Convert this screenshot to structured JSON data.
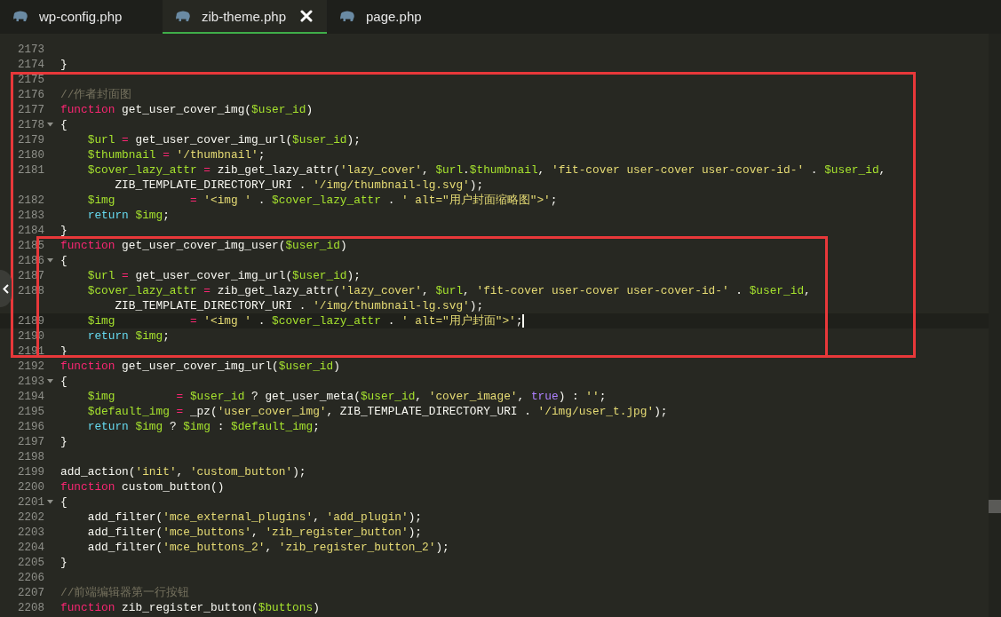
{
  "tabs": [
    {
      "label": "wp-config.php",
      "selected": false
    },
    {
      "label": "zib-theme.php",
      "selected": true
    },
    {
      "label": "page.php",
      "selected": false
    }
  ],
  "editor": {
    "lines": [
      {
        "number": "2173",
        "fold": false,
        "current": false
      },
      {
        "number": "2174",
        "fold": false,
        "current": false,
        "tokens": [
          {
            "kind": "plain",
            "text": "}"
          }
        ]
      },
      {
        "number": "2175",
        "fold": false,
        "current": false
      },
      {
        "number": "2176",
        "fold": false,
        "current": false,
        "tokens": [
          {
            "kind": "comment",
            "text": "//作者封面图"
          }
        ]
      },
      {
        "number": "2177",
        "fold": false,
        "current": false,
        "tokens": [
          {
            "kind": "keyword",
            "text": "function"
          },
          {
            "kind": "plain",
            "text": " get_user_cover_img("
          },
          {
            "kind": "variable",
            "text": "$user_id"
          },
          {
            "kind": "plain",
            "text": ")"
          }
        ]
      },
      {
        "number": "2178",
        "fold": true,
        "current": false,
        "tokens": [
          {
            "kind": "plain",
            "text": "{"
          }
        ]
      },
      {
        "number": "2179",
        "fold": false,
        "current": false,
        "tokens": [
          {
            "kind": "variable",
            "text": "    $url"
          },
          {
            "kind": "operator",
            "text": " ="
          },
          {
            "kind": "plain",
            "text": " get_user_cover_img_url("
          },
          {
            "kind": "variable",
            "text": "$user_id"
          },
          {
            "kind": "plain",
            "text": ");"
          }
        ]
      },
      {
        "number": "2180",
        "fold": false,
        "current": false,
        "tokens": [
          {
            "kind": "variable",
            "text": "    $thumbnail"
          },
          {
            "kind": "operator",
            "text": " ="
          },
          {
            "kind": "string",
            "text": " '/thumbnail'"
          },
          {
            "kind": "plain",
            "text": ";"
          }
        ]
      },
      {
        "number": "2181",
        "fold": false,
        "current": false,
        "tokens": [
          {
            "kind": "variable",
            "text": "    $cover_lazy_attr"
          },
          {
            "kind": "operator",
            "text": " ="
          },
          {
            "kind": "plain",
            "text": " zib_get_lazy_attr("
          },
          {
            "kind": "string",
            "text": "'lazy_cover'"
          },
          {
            "kind": "plain",
            "text": ", "
          },
          {
            "kind": "variable",
            "text": "$url"
          },
          {
            "kind": "plain",
            "text": "."
          },
          {
            "kind": "variable",
            "text": "$thumbnail"
          },
          {
            "kind": "plain",
            "text": ", "
          },
          {
            "kind": "string",
            "text": "'fit-cover user-cover user-cover-id-'"
          },
          {
            "kind": "plain",
            "text": " . "
          },
          {
            "kind": "variable",
            "text": "$user_id"
          },
          {
            "kind": "plain",
            "text": ","
          }
        ],
        "continuation": [
          {
            "kind": "plain",
            "text": "        ZIB_TEMPLATE_DIRECTORY_URI . "
          },
          {
            "kind": "string",
            "text": "'/img/thumbnail-lg.svg'"
          },
          {
            "kind": "plain",
            "text": ");"
          }
        ]
      },
      {
        "number": "2182",
        "fold": false,
        "current": false,
        "tokens": [
          {
            "kind": "variable",
            "text": "    $img"
          },
          {
            "kind": "operator",
            "text": "           ="
          },
          {
            "kind": "string",
            "text": " '<img '"
          },
          {
            "kind": "plain",
            "text": " . "
          },
          {
            "kind": "variable",
            "text": "$cover_lazy_attr"
          },
          {
            "kind": "plain",
            "text": " . "
          },
          {
            "kind": "string",
            "text": "' alt=\"用户封面缩略图\">'"
          },
          {
            "kind": "plain",
            "text": ";"
          }
        ]
      },
      {
        "number": "2183",
        "fold": false,
        "current": false,
        "tokens": [
          {
            "kind": "builtin",
            "text": "    return"
          },
          {
            "kind": "variable",
            "text": " $img"
          },
          {
            "kind": "plain",
            "text": ";"
          }
        ]
      },
      {
        "number": "2184",
        "fold": false,
        "current": false,
        "tokens": [
          {
            "kind": "plain",
            "text": "}"
          }
        ]
      },
      {
        "number": "2185",
        "fold": false,
        "current": false,
        "tokens": [
          {
            "kind": "keyword",
            "text": "function"
          },
          {
            "kind": "plain",
            "text": " get_user_cover_img_user("
          },
          {
            "kind": "variable",
            "text": "$user_id"
          },
          {
            "kind": "plain",
            "text": ")"
          }
        ]
      },
      {
        "number": "2186",
        "fold": true,
        "current": false,
        "tokens": [
          {
            "kind": "plain",
            "text": "{"
          }
        ]
      },
      {
        "number": "2187",
        "fold": false,
        "current": false,
        "tokens": [
          {
            "kind": "variable",
            "text": "    $url"
          },
          {
            "kind": "operator",
            "text": " ="
          },
          {
            "kind": "plain",
            "text": " get_user_cover_img_url("
          },
          {
            "kind": "variable",
            "text": "$user_id"
          },
          {
            "kind": "plain",
            "text": ");"
          }
        ]
      },
      {
        "number": "2188",
        "fold": false,
        "current": false,
        "tokens": [
          {
            "kind": "variable",
            "text": "    $cover_lazy_attr"
          },
          {
            "kind": "operator",
            "text": " ="
          },
          {
            "kind": "plain",
            "text": " zib_get_lazy_attr("
          },
          {
            "kind": "string",
            "text": "'lazy_cover'"
          },
          {
            "kind": "plain",
            "text": ", "
          },
          {
            "kind": "variable",
            "text": "$url"
          },
          {
            "kind": "plain",
            "text": ", "
          },
          {
            "kind": "string",
            "text": "'fit-cover user-cover user-cover-id-'"
          },
          {
            "kind": "plain",
            "text": " . "
          },
          {
            "kind": "variable",
            "text": "$user_id"
          },
          {
            "kind": "plain",
            "text": ","
          }
        ],
        "continuation": [
          {
            "kind": "plain",
            "text": "        ZIB_TEMPLATE_DIRECTORY_URI . "
          },
          {
            "kind": "string",
            "text": "'/img/thumbnail-lg.svg'"
          },
          {
            "kind": "plain",
            "text": ");"
          }
        ]
      },
      {
        "number": "2189",
        "fold": false,
        "current": true,
        "tokens": [
          {
            "kind": "variable",
            "text": "    $img"
          },
          {
            "kind": "operator",
            "text": "           ="
          },
          {
            "kind": "string",
            "text": " '<img '"
          },
          {
            "kind": "plain",
            "text": " . "
          },
          {
            "kind": "variable",
            "text": "$cover_lazy_attr"
          },
          {
            "kind": "plain",
            "text": " . "
          },
          {
            "kind": "string",
            "text": "' alt=\"用户封面\">'"
          },
          {
            "kind": "plain",
            "text": ";"
          }
        ]
      },
      {
        "number": "2190",
        "fold": false,
        "current": false,
        "tokens": [
          {
            "kind": "builtin",
            "text": "    return"
          },
          {
            "kind": "variable",
            "text": " $img"
          },
          {
            "kind": "plain",
            "text": ";"
          }
        ]
      },
      {
        "number": "2191",
        "fold": false,
        "current": false,
        "tokens": [
          {
            "kind": "plain",
            "text": "}"
          }
        ]
      },
      {
        "number": "2192",
        "fold": false,
        "current": false,
        "tokens": [
          {
            "kind": "keyword",
            "text": "function"
          },
          {
            "kind": "plain",
            "text": " get_user_cover_img_url("
          },
          {
            "kind": "variable",
            "text": "$user_id"
          },
          {
            "kind": "plain",
            "text": ")"
          }
        ]
      },
      {
        "number": "2193",
        "fold": true,
        "current": false,
        "tokens": [
          {
            "kind": "plain",
            "text": "{"
          }
        ]
      },
      {
        "number": "2194",
        "fold": false,
        "current": false,
        "tokens": [
          {
            "kind": "variable",
            "text": "    $img"
          },
          {
            "kind": "operator",
            "text": "         ="
          },
          {
            "kind": "variable",
            "text": " $user_id"
          },
          {
            "kind": "plain",
            "text": " ? get_user_meta("
          },
          {
            "kind": "variable",
            "text": "$user_id"
          },
          {
            "kind": "plain",
            "text": ", "
          },
          {
            "kind": "string",
            "text": "'cover_image'"
          },
          {
            "kind": "plain",
            "text": ", "
          },
          {
            "kind": "constant",
            "text": "true"
          },
          {
            "kind": "plain",
            "text": ") : "
          },
          {
            "kind": "string",
            "text": "''"
          },
          {
            "kind": "plain",
            "text": ";"
          }
        ]
      },
      {
        "number": "2195",
        "fold": false,
        "current": false,
        "tokens": [
          {
            "kind": "variable",
            "text": "    $default_img"
          },
          {
            "kind": "operator",
            "text": " ="
          },
          {
            "kind": "plain",
            "text": " _pz("
          },
          {
            "kind": "string",
            "text": "'user_cover_img'"
          },
          {
            "kind": "plain",
            "text": ", ZIB_TEMPLATE_DIRECTORY_URI . "
          },
          {
            "kind": "string",
            "text": "'/img/user_t.jpg'"
          },
          {
            "kind": "plain",
            "text": ");"
          }
        ]
      },
      {
        "number": "2196",
        "fold": false,
        "current": false,
        "tokens": [
          {
            "kind": "builtin",
            "text": "    return"
          },
          {
            "kind": "variable",
            "text": " $img"
          },
          {
            "kind": "plain",
            "text": " ? "
          },
          {
            "kind": "variable",
            "text": "$img"
          },
          {
            "kind": "plain",
            "text": " : "
          },
          {
            "kind": "variable",
            "text": "$default_img"
          },
          {
            "kind": "plain",
            "text": ";"
          }
        ]
      },
      {
        "number": "2197",
        "fold": false,
        "current": false,
        "tokens": [
          {
            "kind": "plain",
            "text": "}"
          }
        ]
      },
      {
        "number": "2198",
        "fold": false,
        "current": false
      },
      {
        "number": "2199",
        "fold": false,
        "current": false,
        "tokens": [
          {
            "kind": "plain",
            "text": "add_action("
          },
          {
            "kind": "string",
            "text": "'init'"
          },
          {
            "kind": "plain",
            "text": ", "
          },
          {
            "kind": "string",
            "text": "'custom_button'"
          },
          {
            "kind": "plain",
            "text": ");"
          }
        ]
      },
      {
        "number": "2200",
        "fold": false,
        "current": false,
        "tokens": [
          {
            "kind": "keyword",
            "text": "function"
          },
          {
            "kind": "plain",
            "text": " custom_button()"
          }
        ]
      },
      {
        "number": "2201",
        "fold": true,
        "current": false,
        "tokens": [
          {
            "kind": "plain",
            "text": "{"
          }
        ]
      },
      {
        "number": "2202",
        "fold": false,
        "current": false,
        "tokens": [
          {
            "kind": "plain",
            "text": "    add_filter("
          },
          {
            "kind": "string",
            "text": "'mce_external_plugins'"
          },
          {
            "kind": "plain",
            "text": ", "
          },
          {
            "kind": "string",
            "text": "'add_plugin'"
          },
          {
            "kind": "plain",
            "text": ");"
          }
        ]
      },
      {
        "number": "2203",
        "fold": false,
        "current": false,
        "tokens": [
          {
            "kind": "plain",
            "text": "    add_filter("
          },
          {
            "kind": "string",
            "text": "'mce_buttons'"
          },
          {
            "kind": "plain",
            "text": ", "
          },
          {
            "kind": "string",
            "text": "'zib_register_button'"
          },
          {
            "kind": "plain",
            "text": ");"
          }
        ]
      },
      {
        "number": "2204",
        "fold": false,
        "current": false,
        "tokens": [
          {
            "kind": "plain",
            "text": "    add_filter("
          },
          {
            "kind": "string",
            "text": "'mce_buttons_2'"
          },
          {
            "kind": "plain",
            "text": ", "
          },
          {
            "kind": "string",
            "text": "'zib_register_button_2'"
          },
          {
            "kind": "plain",
            "text": ");"
          }
        ]
      },
      {
        "number": "2205",
        "fold": false,
        "current": false,
        "tokens": [
          {
            "kind": "plain",
            "text": "}"
          }
        ]
      },
      {
        "number": "2206",
        "fold": false,
        "current": false
      },
      {
        "number": "2207",
        "fold": false,
        "current": false,
        "tokens": [
          {
            "kind": "comment",
            "text": "//前端编辑器第一行按钮"
          }
        ]
      },
      {
        "number": "2208",
        "fold": false,
        "current": false,
        "tokens": [
          {
            "kind": "keyword",
            "text": "function"
          },
          {
            "kind": "plain",
            "text": " zib_register_button("
          },
          {
            "kind": "variable",
            "text": "$buttons"
          },
          {
            "kind": "plain",
            "text": ")"
          }
        ]
      }
    ],
    "annotation_boxes": [
      {
        "color": "#e8383a"
      },
      {
        "color": "#e8383a"
      }
    ]
  }
}
